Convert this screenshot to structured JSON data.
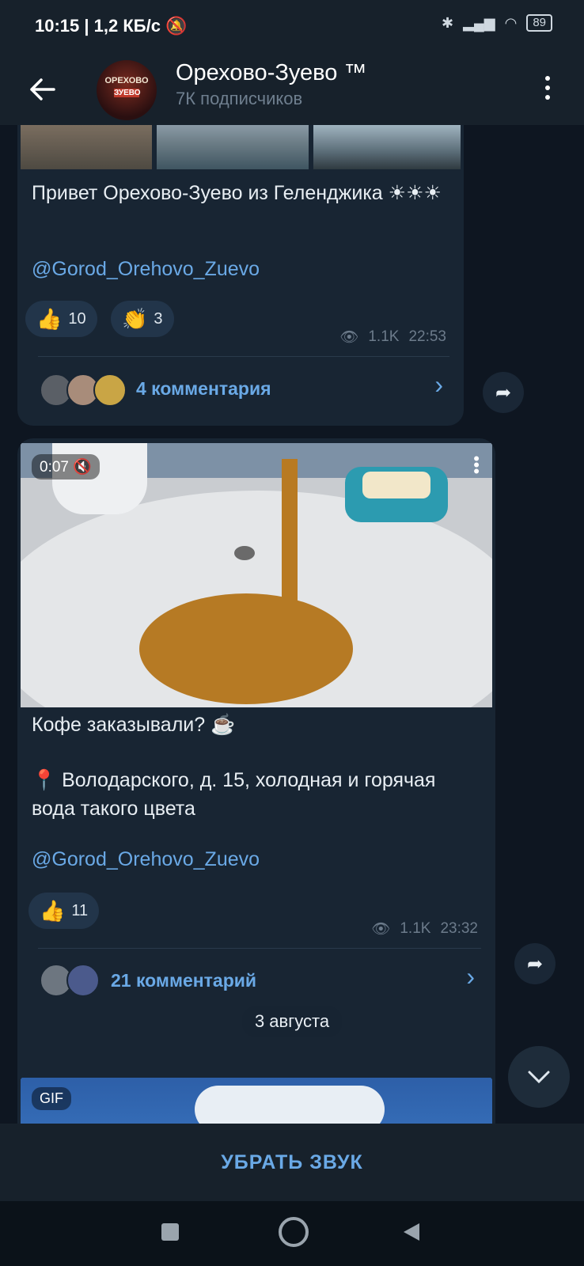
{
  "status_bar": {
    "time": "10:15",
    "speed": "1,2 КБ/с",
    "battery": "89",
    "icons": [
      "silent-bell-icon",
      "bluetooth-icon",
      "signal-icon",
      "wifi-icon",
      "battery-icon"
    ]
  },
  "header": {
    "channel_title": "Орехово-Зуево ™",
    "subscribers": "7К подписчиков",
    "avatar_line1": "ОРЕХОВО",
    "avatar_line2": "ЗУЕВО"
  },
  "posts": [
    {
      "text": "Привет Орехово-Зуево из Геленджика ☀☀☀",
      "link": "@Gorod_Orehovo_Zuevo",
      "reactions": [
        {
          "emoji": "👍",
          "count": "10"
        },
        {
          "emoji": "👏",
          "count": "3"
        }
      ],
      "views": "1.1K",
      "time": "22:53",
      "comments": "4 комментария"
    },
    {
      "video_time": "0:07",
      "text1": "Кофе заказывали? ☕",
      "text2": "📍 Володарского, д. 15, холодная и горячая вода такого цвета",
      "link": "@Gorod_Orehovo_Zuevo",
      "reactions": [
        {
          "emoji": "👍",
          "count": "11"
        }
      ],
      "views": "1.1K",
      "time": "23:32",
      "comments": "21 комментарий"
    }
  ],
  "date_separator": "3 августа",
  "gif_badge": "GIF",
  "bottom_action": "УБРАТЬ ЗВУК",
  "colors": {
    "background": "#0e1621",
    "bubble": "#182533",
    "header": "#17212b",
    "accent": "#6aa9e6"
  }
}
